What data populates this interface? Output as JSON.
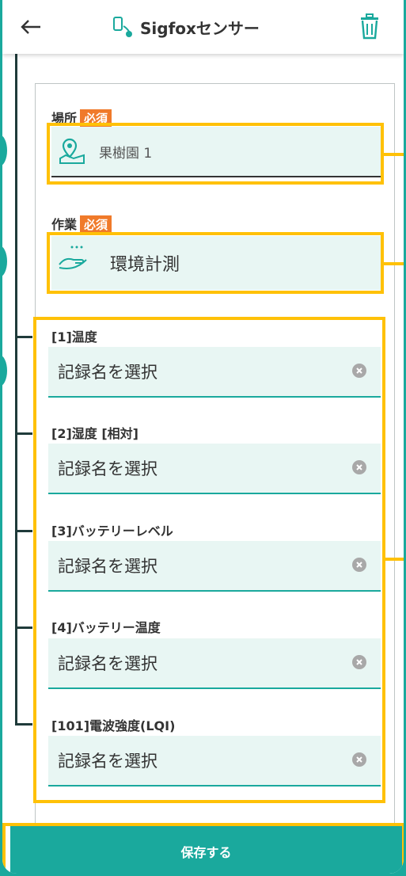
{
  "header": {
    "title": "Sigfoxセンサー",
    "back_icon": "arrow-left-icon",
    "device_icon": "sensor-device-icon",
    "trash_icon": "trash-icon"
  },
  "location": {
    "label": "場所",
    "required": "必須",
    "value": "果樹園 1",
    "icon": "map-pin-icon"
  },
  "task": {
    "label": "作業",
    "required": "必須",
    "value": "環境計測",
    "icon": "hand-icon"
  },
  "records": [
    {
      "label": "[1]温度",
      "placeholder": "記録名を選択"
    },
    {
      "label": "[2]湿度 [相対]",
      "placeholder": "記録名を選択"
    },
    {
      "label": "[3]バッテリーレベル",
      "placeholder": "記録名を選択"
    },
    {
      "label": "[4]バッテリー温度",
      "placeholder": "記録名を選択"
    },
    {
      "label": "[101]電波強度(LQI)",
      "placeholder": "記録名を選択"
    }
  ],
  "save_button": "保存する",
  "colors": {
    "accent": "#1aa99d",
    "required_badge": "#f07a2a",
    "highlight": "#ffc107",
    "field_bg": "#e8f6f3"
  }
}
